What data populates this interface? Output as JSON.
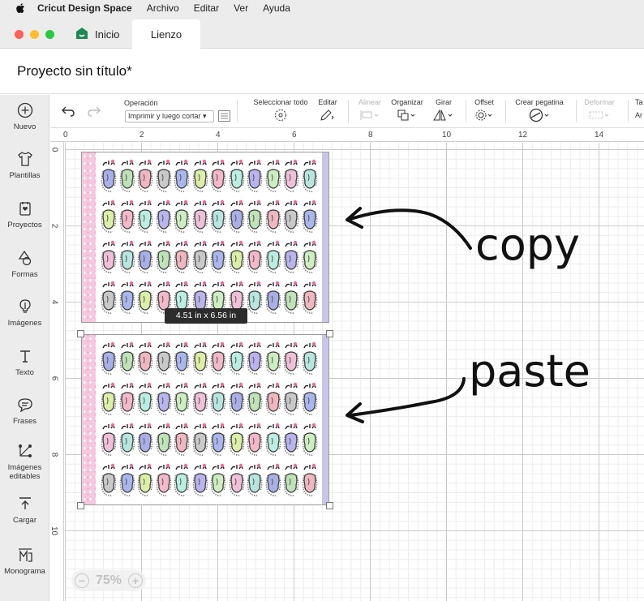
{
  "menubar": {
    "app_name": "Cricut Design Space",
    "items": [
      "Archivo",
      "Editar",
      "Ver",
      "Ayuda"
    ]
  },
  "tabs": {
    "home_label": "Inicio",
    "canvas_label": "Lienzo"
  },
  "project": {
    "title": "Proyecto sin título*"
  },
  "sidebar": {
    "items": [
      {
        "label": "Nuevo",
        "icon": "plus-circle-icon"
      },
      {
        "label": "Plantillas",
        "icon": "shirt-icon"
      },
      {
        "label": "Proyectos",
        "icon": "projects-icon"
      },
      {
        "label": "Formas",
        "icon": "shapes-icon"
      },
      {
        "label": "Imágenes",
        "icon": "lightbulb-icon"
      },
      {
        "label": "Texto",
        "icon": "text-icon"
      },
      {
        "label": "Frases",
        "icon": "speech-bubble-icon"
      },
      {
        "label": "Imágenes editables",
        "icon": "editable-images-icon"
      },
      {
        "label": "Cargar",
        "icon": "upload-icon"
      },
      {
        "label": "Monograma",
        "icon": "monogram-icon"
      }
    ]
  },
  "toolbar": {
    "operation_label": "Operación",
    "operation_value": "Imprimir y luego cortar",
    "select_all_label": "Seleccionar todo",
    "edit_label": "Editar",
    "align_label": "Alinear",
    "arrange_label": "Organizar",
    "rotate_label": "Girar",
    "offset_label": "Offset",
    "sticker_label": "Crear pegatina",
    "warp_label": "Deformar",
    "size_label_cut": "Ta",
    "size_label_cut2": "Ar"
  },
  "rulers": {
    "top": [
      "0",
      "2",
      "4",
      "6",
      "8",
      "10",
      "12",
      "14"
    ],
    "left": [
      "0",
      "2",
      "4",
      "6",
      "8",
      "10"
    ]
  },
  "selection": {
    "dimensions": "4.51  in x 6.56  in"
  },
  "annotations": {
    "copy": "copy",
    "paste": "paste"
  },
  "zoom": {
    "level": "75%",
    "minus": "−",
    "plus": "+"
  },
  "colors": {
    "accent_green": "#1d8a54",
    "sticker_colors": [
      "#a9b0e8",
      "#bfe3b7",
      "#f0b7c0",
      "#c9c9c9",
      "#aab7ee",
      "#dcefa6",
      "#f3b8c9",
      "#b9eee1",
      "#b9b3ee",
      "#cdeec0",
      "#efc0d8",
      "#b7e6e0"
    ]
  }
}
